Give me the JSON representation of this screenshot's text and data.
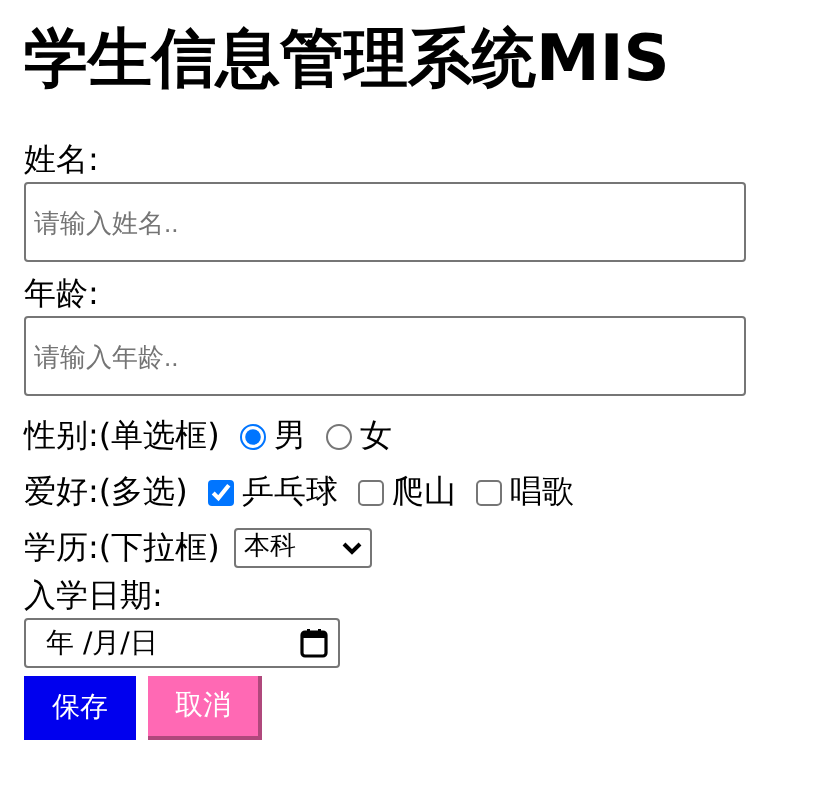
{
  "title": "学生信息管理系统MIS",
  "name_field": {
    "label": "姓名:",
    "placeholder": "请输入姓名.."
  },
  "age_field": {
    "label": "年龄:",
    "placeholder": "请输入年龄.."
  },
  "gender": {
    "label": "性别:(单选框)",
    "options": [
      {
        "label": "男",
        "selected": true
      },
      {
        "label": "女",
        "selected": false
      }
    ]
  },
  "hobbies": {
    "label": "爱好:(多选)",
    "options": [
      {
        "label": "乒乓球",
        "checked": true
      },
      {
        "label": "爬山",
        "checked": false
      },
      {
        "label": "唱歌",
        "checked": false
      }
    ]
  },
  "education": {
    "label": "学历:(下拉框)",
    "value": "本科"
  },
  "enroll_date": {
    "label": "入学日期:",
    "value": "年 /月/日"
  },
  "buttons": [
    {
      "label": "保存",
      "kind": "save"
    },
    {
      "label": "取消",
      "kind": "cancel"
    }
  ]
}
